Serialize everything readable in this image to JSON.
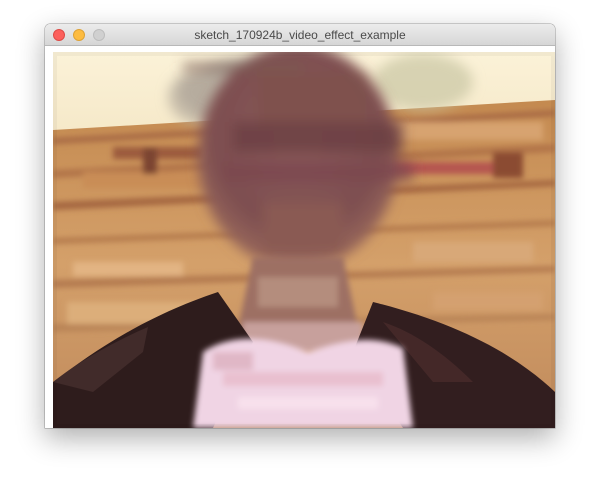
{
  "window": {
    "title": "sketch_170924b_video_effect_example"
  },
  "icons": {
    "close": "close-window-icon",
    "minimize": "minimize-window-icon",
    "zoom": "zoom-window-icon"
  },
  "colors": {
    "close": "#fc605c",
    "minimize": "#fdbc40",
    "zoom": "#d0d0d0",
    "wall": "#f9efd2",
    "wood": "#c99258",
    "shirt_dark": "#2e1b1b",
    "shirt_light": "#f1d4e3"
  },
  "canvas": {
    "content": "posterized-webcam-video-frame"
  }
}
